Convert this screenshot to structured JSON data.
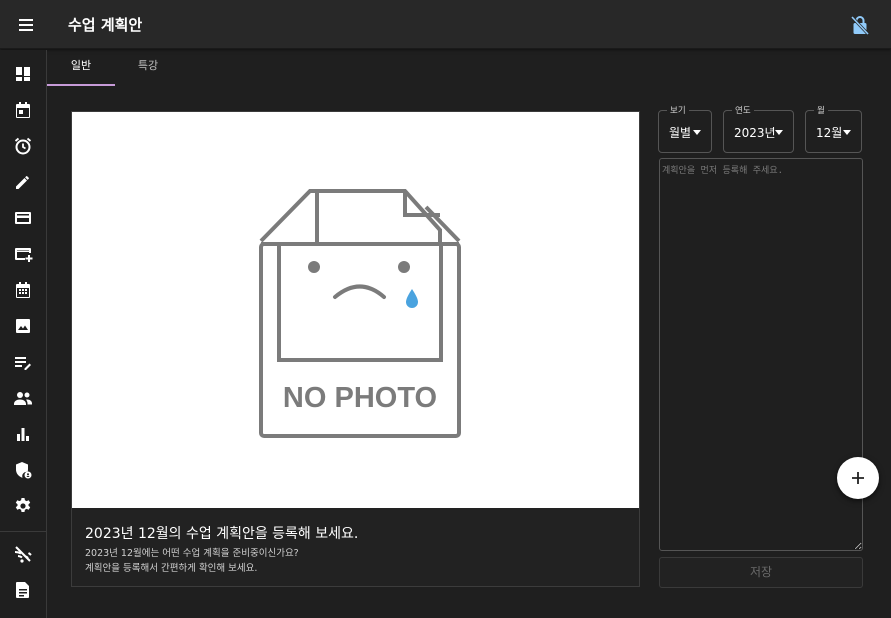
{
  "app": {
    "title": "수업 계획안"
  },
  "appbar": {
    "menu_icon": "menu-icon",
    "lock_icon": "lock-off-icon"
  },
  "sidebar": {
    "items": [
      {
        "icon": "dashboard-icon"
      },
      {
        "icon": "calendar-today-icon"
      },
      {
        "icon": "alarm-icon"
      },
      {
        "icon": "pencil-icon"
      },
      {
        "icon": "credit-card-icon"
      },
      {
        "icon": "add-card-icon"
      },
      {
        "icon": "calendar-month-icon"
      },
      {
        "icon": "image-icon"
      },
      {
        "icon": "edit-note-icon"
      },
      {
        "icon": "people-icon"
      },
      {
        "icon": "bar-chart-icon"
      },
      {
        "icon": "admin-shield-icon"
      },
      {
        "icon": "settings-icon"
      },
      {
        "icon": "wifi-off-icon"
      },
      {
        "icon": "document-icon"
      }
    ]
  },
  "tabs": [
    {
      "label": "일반",
      "active": true
    },
    {
      "label": "특강",
      "active": false
    }
  ],
  "card": {
    "image_alt": "NO PHOTO",
    "title": "2023년 12월의 수업 계획안을 등록해 보세요.",
    "line1": "2023년 12월에는 어떤 수업 계획을 준비중이신가요?",
    "line2": "계획안을 등록해서 간편하게 확인해 보세요."
  },
  "filters": {
    "view": {
      "label": "보기",
      "value": "월별"
    },
    "year": {
      "label": "연도",
      "value": "2023년"
    },
    "month": {
      "label": "월",
      "value": "12월"
    }
  },
  "plan": {
    "placeholder": "계획안을 먼저 등록해 주세요.",
    "value": ""
  },
  "save_label": "저장",
  "fab": {
    "icon": "plus-icon"
  },
  "colors": {
    "tab_indicator": "#c79bd8",
    "lock_icon": "#90caf9",
    "tear": "#4aa3df"
  }
}
